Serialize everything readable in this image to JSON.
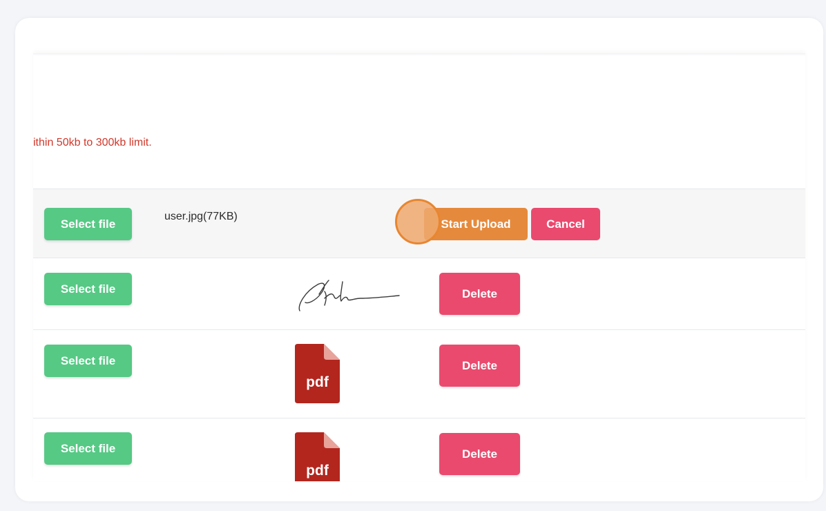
{
  "note": "ithin 50kb to 300kb limit.",
  "rows": [
    {
      "select_label": "Select file",
      "file_name": "user.jpg(77KB)",
      "upload_label": "Start Upload",
      "cancel_label": "Cancel"
    },
    {
      "select_label": "Select file",
      "delete_label": "Delete",
      "preview": "signature"
    },
    {
      "select_label": "Select file",
      "delete_label": "Delete",
      "preview": "pdf",
      "preview_text": "pdf"
    },
    {
      "select_label": "Select file",
      "delete_label": "Delete",
      "preview": "pdf",
      "preview_text": "pdf"
    }
  ],
  "colors": {
    "select": "#56c985",
    "upload": "#e58a3c",
    "delete": "#ea4a6e",
    "note": "#d0372a",
    "pdf": "#b3261e"
  }
}
